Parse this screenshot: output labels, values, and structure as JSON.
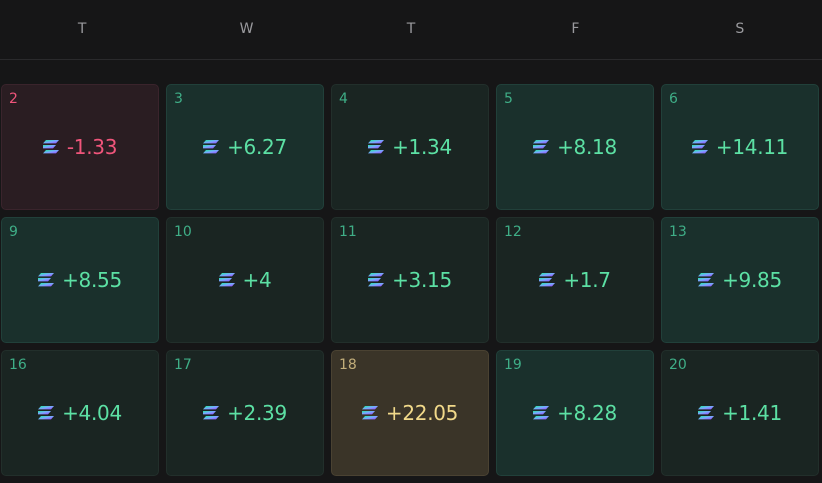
{
  "weekdays": [
    "T",
    "W",
    "T",
    "F",
    "S"
  ],
  "colors": {
    "negative": "#f0557b",
    "positive": "#5ce0a4",
    "best": "#f1d98a",
    "sol_gradient": [
      "#9945ff",
      "#14f195"
    ]
  },
  "days": [
    {
      "day": "2",
      "pnl": "-1.33",
      "tone": "neg"
    },
    {
      "day": "3",
      "pnl": "+6.27",
      "tone": "pos-strong"
    },
    {
      "day": "4",
      "pnl": "+1.34",
      "tone": "pos-weak"
    },
    {
      "day": "5",
      "pnl": "+8.18",
      "tone": "pos-strong"
    },
    {
      "day": "6",
      "pnl": "+14.11",
      "tone": "pos-strong"
    },
    {
      "day": "9",
      "pnl": "+8.55",
      "tone": "pos-strong"
    },
    {
      "day": "10",
      "pnl": "+4",
      "tone": "pos-weak"
    },
    {
      "day": "11",
      "pnl": "+3.15",
      "tone": "pos-weak"
    },
    {
      "day": "12",
      "pnl": "+1.7",
      "tone": "pos-weak"
    },
    {
      "day": "13",
      "pnl": "+9.85",
      "tone": "pos-strong"
    },
    {
      "day": "16",
      "pnl": "+4.04",
      "tone": "pos-weak"
    },
    {
      "day": "17",
      "pnl": "+2.39",
      "tone": "pos-weak"
    },
    {
      "day": "18",
      "pnl": "+22.05",
      "tone": "best"
    },
    {
      "day": "19",
      "pnl": "+8.28",
      "tone": "pos-strong"
    },
    {
      "day": "20",
      "pnl": "+1.41",
      "tone": "pos-weak"
    }
  ]
}
